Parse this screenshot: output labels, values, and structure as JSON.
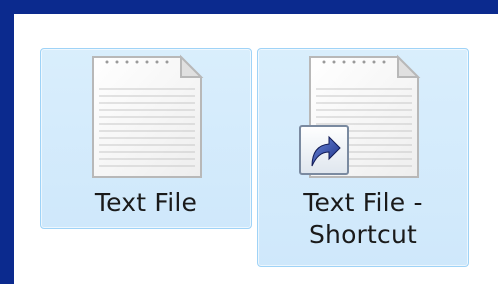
{
  "files": [
    {
      "name": "Text File",
      "icon": "text-file-icon",
      "selected": true
    },
    {
      "name_line1": "Text File -",
      "name_line2": "Shortcut",
      "icon": "text-file-icon",
      "overlay_icon": "shortcut-arrow-icon",
      "selected": true
    }
  ],
  "colors": {
    "window_border": "#0b2a8e",
    "selection_fill": "#d9eefc",
    "selection_border": "#9fd3f7"
  }
}
